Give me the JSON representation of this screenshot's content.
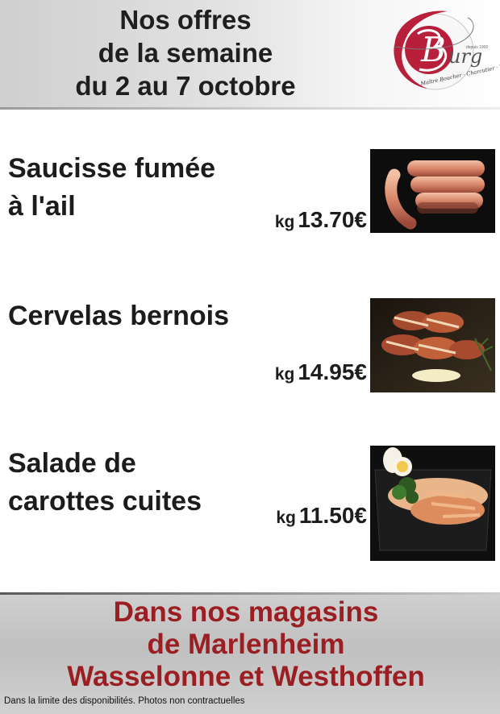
{
  "header": {
    "title_lines": [
      "Nos offres",
      "de la semaine",
      "du 2 au 7 octobre"
    ]
  },
  "logo": {
    "initial": "B",
    "script_text": "urg",
    "tagline": "Maître Boucher · Charcutier · Traiteur",
    "since": "depuis 1900",
    "accent_color": "#b81f3a"
  },
  "products": [
    {
      "name_lines": [
        "Saucisse fumée",
        "à l'ail"
      ],
      "unit": "kg",
      "price": "13.70€",
      "photo_icon": "smoked-sausage-photo"
    },
    {
      "name_lines": [
        "Cervelas bernois"
      ],
      "unit": "kg",
      "price": "14.95€",
      "photo_icon": "cervelas-bacon-photo"
    },
    {
      "name_lines": [
        "Salade de",
        "carottes cuites"
      ],
      "unit": "kg",
      "price": "11.50€",
      "photo_icon": "carrot-salad-photo"
    }
  ],
  "footer": {
    "lines": [
      "Dans nos magasins",
      "de Marlenheim",
      "Wasselonne et Westhoffen"
    ],
    "footnote": "Dans la limite des disponibilités. Photos non contractuelles",
    "text_color": "#9b1f22"
  }
}
